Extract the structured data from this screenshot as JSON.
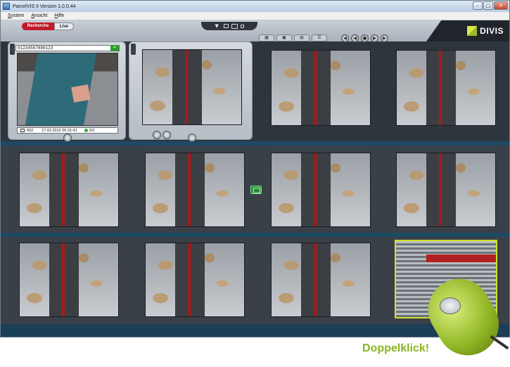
{
  "window": {
    "title": "ParcelVIS II Version 1.0.0.44",
    "controls": {
      "minimize": "–",
      "maximize": "□",
      "close": "✕"
    }
  },
  "menu": {
    "items": [
      "System",
      "Ansicht",
      "Hilfe"
    ]
  },
  "tabs": {
    "recherche": "Recherche",
    "live": "Live"
  },
  "layout_controls": {
    "arrow": "▼"
  },
  "logo": {
    "text": "DIVIS"
  },
  "view_tabs": [
    "▦",
    "▣",
    "▤",
    "☰"
  ],
  "nav_buttons": [
    "◀",
    "◀",
    "●",
    "▶",
    "▶"
  ],
  "detail": {
    "barcode": "01234567890123",
    "barcode_button": "↵",
    "status": {
      "camera_number": "002",
      "timestamp": "17.02.2012 06:31:41",
      "page": "2/2"
    }
  },
  "colors": {
    "accent_red": "#c21a2a",
    "brand_green": "#8ab51f",
    "selection": "#cfe02a",
    "status_ok": "#2fae2f"
  },
  "overlay": {
    "caption": "Doppelklick!"
  }
}
